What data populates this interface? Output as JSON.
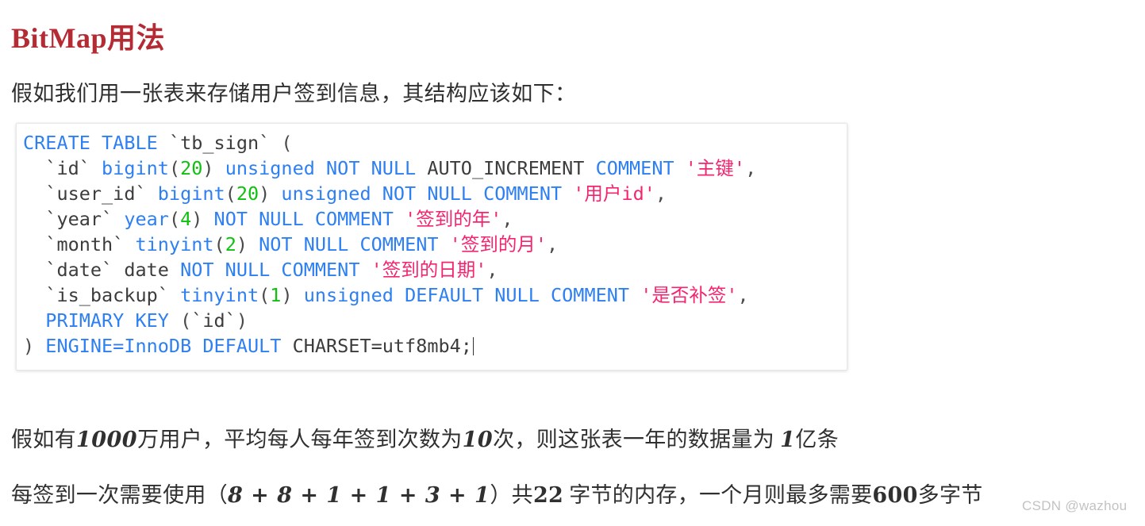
{
  "document": {
    "title": "BitMap用法",
    "title_color": "#b42b34",
    "background": "#ffffff"
  },
  "intro": {
    "text": "假如我们用一张表来存储用户签到信息，其结构应该如下："
  },
  "code_block": {
    "language": "sql",
    "colors": {
      "keyword": "#2e80f2",
      "identifier": "#3c3c3c",
      "number": "#0fc10f",
      "string": "#f4256f",
      "background": "#ffffff"
    },
    "caret_visible": true,
    "plain_text": ")  ENGINE=InnoDB DEFAULT CHARSET=utf8mb4;",
    "lines": [
      {
        "index": 0,
        "tokens": [
          {
            "t": "CREATE TABLE ",
            "c": "k"
          },
          {
            "t": "`tb_sign` ",
            "c": "id"
          },
          {
            "t": "(",
            "c": "p"
          }
        ]
      },
      {
        "index": 1,
        "tokens": [
          {
            "t": "  `id` ",
            "c": "id"
          },
          {
            "t": "bigint",
            "c": "k"
          },
          {
            "t": "(",
            "c": "p"
          },
          {
            "t": "20",
            "c": "n"
          },
          {
            "t": ") ",
            "c": "p"
          },
          {
            "t": "unsigned NOT NULL ",
            "c": "k"
          },
          {
            "t": "AUTO_INCREMENT ",
            "c": "id"
          },
          {
            "t": "COMMENT ",
            "c": "k"
          },
          {
            "t": "'主键'",
            "c": "s"
          },
          {
            "t": ",",
            "c": "p"
          }
        ]
      },
      {
        "index": 2,
        "tokens": [
          {
            "t": "  `user_id` ",
            "c": "id"
          },
          {
            "t": "bigint",
            "c": "k"
          },
          {
            "t": "(",
            "c": "p"
          },
          {
            "t": "20",
            "c": "n"
          },
          {
            "t": ") ",
            "c": "p"
          },
          {
            "t": "unsigned NOT NULL COMMENT ",
            "c": "k"
          },
          {
            "t": "'用户id'",
            "c": "s"
          },
          {
            "t": ",",
            "c": "p"
          }
        ]
      },
      {
        "index": 3,
        "tokens": [
          {
            "t": "  `year` ",
            "c": "id"
          },
          {
            "t": "year",
            "c": "k"
          },
          {
            "t": "(",
            "c": "p"
          },
          {
            "t": "4",
            "c": "n"
          },
          {
            "t": ") ",
            "c": "p"
          },
          {
            "t": "NOT NULL COMMENT ",
            "c": "k"
          },
          {
            "t": "'签到的年'",
            "c": "s"
          },
          {
            "t": ",",
            "c": "p"
          }
        ]
      },
      {
        "index": 4,
        "tokens": [
          {
            "t": "  `month` ",
            "c": "id"
          },
          {
            "t": "tinyint",
            "c": "k"
          },
          {
            "t": "(",
            "c": "p"
          },
          {
            "t": "2",
            "c": "n"
          },
          {
            "t": ") ",
            "c": "p"
          },
          {
            "t": "NOT NULL COMMENT ",
            "c": "k"
          },
          {
            "t": "'签到的月'",
            "c": "s"
          },
          {
            "t": ",",
            "c": "p"
          }
        ]
      },
      {
        "index": 5,
        "tokens": [
          {
            "t": "  `date` ",
            "c": "id"
          },
          {
            "t": "date ",
            "c": "id"
          },
          {
            "t": "NOT NULL COMMENT ",
            "c": "k"
          },
          {
            "t": "'签到的日期'",
            "c": "s"
          },
          {
            "t": ",",
            "c": "p"
          }
        ]
      },
      {
        "index": 6,
        "tokens": [
          {
            "t": "  `is_backup` ",
            "c": "id"
          },
          {
            "t": "tinyint",
            "c": "k"
          },
          {
            "t": "(",
            "c": "p"
          },
          {
            "t": "1",
            "c": "n"
          },
          {
            "t": ") ",
            "c": "p"
          },
          {
            "t": "unsigned DEFAULT NULL COMMENT ",
            "c": "k"
          },
          {
            "t": "'是否补签'",
            "c": "s"
          },
          {
            "t": ",",
            "c": "p"
          }
        ]
      },
      {
        "index": 7,
        "tokens": [
          {
            "t": "  PRIMARY KEY ",
            "c": "k"
          },
          {
            "t": "(",
            "c": "p"
          },
          {
            "t": "`id`",
            "c": "id"
          },
          {
            "t": ")",
            "c": "p"
          }
        ]
      },
      {
        "index": 8,
        "tokens": [
          {
            "t": ") ",
            "c": "p"
          },
          {
            "t": "ENGINE=InnoDB DEFAULT ",
            "c": "k"
          },
          {
            "t": "CHARSET=utf8mb4;",
            "c": "id"
          }
        ]
      }
    ]
  },
  "notes": {
    "line1": {
      "full_text": "假如有1000万用户，平均每人每年签到次数为10次，则这张表一年的数据量为 1亿条",
      "parts": [
        {
          "t": "假如有",
          "style": "cjk"
        },
        {
          "t": "1000",
          "style": "num"
        },
        {
          "t": "万用户，平均每人每年签到次数为",
          "style": "cjk"
        },
        {
          "t": "10",
          "style": "num"
        },
        {
          "t": "次，则这张表一年的数据量为 ",
          "style": "cjk"
        },
        {
          "t": "1",
          "style": "num"
        },
        {
          "t": "亿条",
          "style": "cjk"
        }
      ]
    },
    "line2": {
      "full_text": "每签到一次需要使用（8 + 8 + 1 + 1 + 3 + 1）共22 字节的内存，一个月则最多需要600多字节",
      "parts": [
        {
          "t": "每签到一次需要使用（",
          "style": "cjk"
        },
        {
          "t": "8 + 8 + 1 + 1 + 3 + 1",
          "style": "num"
        },
        {
          "t": "）共",
          "style": "cjk"
        },
        {
          "t": "22",
          "style": "num-plain"
        },
        {
          "t": " 字节的内存，一个月则最多需要",
          "style": "cjk"
        },
        {
          "t": "600",
          "style": "num-plain"
        },
        {
          "t": "多字节",
          "style": "cjk"
        }
      ]
    }
  },
  "watermark": {
    "text": "CSDN @wazhou"
  }
}
